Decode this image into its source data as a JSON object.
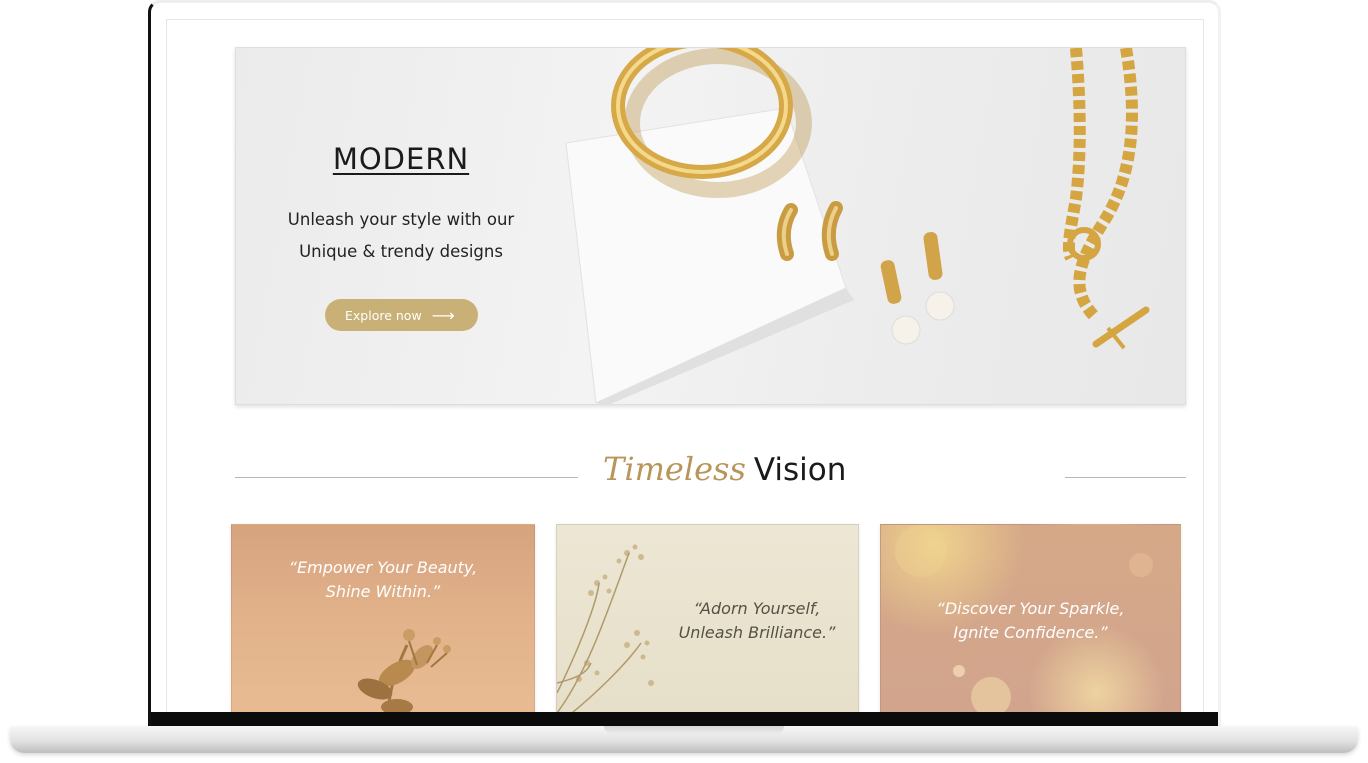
{
  "hero": {
    "title": "MODERN",
    "subtitle_line1": "Unleash your style with our",
    "subtitle_line2": "Unique & trendy designs",
    "cta_label": "Explore now",
    "cta_arrow": "⟶"
  },
  "section": {
    "heading_script": "Timeless",
    "heading_plain": "Vision"
  },
  "cards": [
    {
      "quote_line1": "“Empower Your Beauty,",
      "quote_line2": "Shine Within.”"
    },
    {
      "quote_line1": "“Adorn Yourself,",
      "quote_line2": "Unleash Brilliance.”"
    },
    {
      "quote_line1": "“Discover Your Sparkle,",
      "quote_line2": "Ignite Confidence.”"
    }
  ],
  "colors": {
    "accent_gold": "#c9b076",
    "script_gold": "#b8955a",
    "jewelry_gold": "#d9ac4e"
  }
}
